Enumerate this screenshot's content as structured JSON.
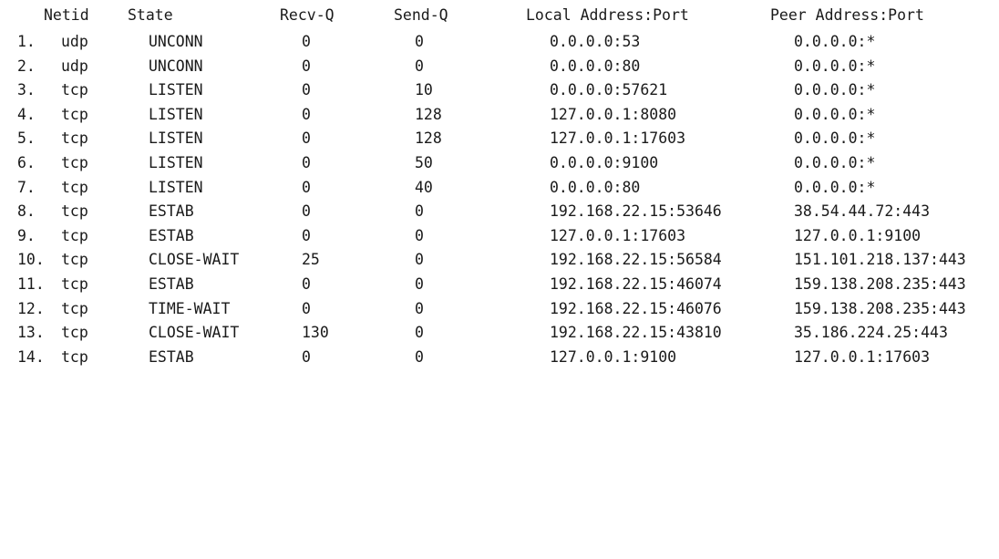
{
  "headers": {
    "netid": "Netid",
    "state": "State",
    "recv_q": "Recv-Q",
    "send_q": "Send-Q",
    "local": "Local Address:Port",
    "peer": "Peer Address:Port"
  },
  "rows": [
    {
      "num": "1.",
      "netid": "udp",
      "state": "UNCONN",
      "recv_q": "0",
      "send_q": "0",
      "local": "0.0.0.0:53",
      "peer": "0.0.0.0:*"
    },
    {
      "num": "2.",
      "netid": "udp",
      "state": "UNCONN",
      "recv_q": "0",
      "send_q": "0",
      "local": "0.0.0.0:80",
      "peer": "0.0.0.0:*"
    },
    {
      "num": "3.",
      "netid": "tcp",
      "state": "LISTEN",
      "recv_q": "0",
      "send_q": "10",
      "local": "0.0.0.0:57621",
      "peer": "0.0.0.0:*"
    },
    {
      "num": "4.",
      "netid": "tcp",
      "state": "LISTEN",
      "recv_q": "0",
      "send_q": "128",
      "local": "127.0.0.1:8080",
      "peer": "0.0.0.0:*"
    },
    {
      "num": "5.",
      "netid": "tcp",
      "state": "LISTEN",
      "recv_q": "0",
      "send_q": "128",
      "local": "127.0.0.1:17603",
      "peer": "0.0.0.0:*"
    },
    {
      "num": "6.",
      "netid": "tcp",
      "state": "LISTEN",
      "recv_q": "0",
      "send_q": "50",
      "local": "0.0.0.0:9100",
      "peer": "0.0.0.0:*"
    },
    {
      "num": "7.",
      "netid": "tcp",
      "state": "LISTEN",
      "recv_q": "0",
      "send_q": "40",
      "local": "0.0.0.0:80",
      "peer": "0.0.0.0:*"
    },
    {
      "num": "8.",
      "netid": "tcp",
      "state": "ESTAB",
      "recv_q": "0",
      "send_q": "0",
      "local": "192.168.22.15:53646",
      "peer": "38.54.44.72:443"
    },
    {
      "num": "9.",
      "netid": "tcp",
      "state": "ESTAB",
      "recv_q": "0",
      "send_q": "0",
      "local": "127.0.0.1:17603",
      "peer": "127.0.0.1:9100"
    },
    {
      "num": "10.",
      "netid": "tcp",
      "state": "CLOSE-WAIT",
      "recv_q": "25",
      "send_q": "0",
      "local": "192.168.22.15:56584",
      "peer": "151.101.218.137:443"
    },
    {
      "num": "11.",
      "netid": "tcp",
      "state": "ESTAB",
      "recv_q": "0",
      "send_q": "0",
      "local": "192.168.22.15:46074",
      "peer": "159.138.208.235:443"
    },
    {
      "num": "12.",
      "netid": "tcp",
      "state": "TIME-WAIT",
      "recv_q": "0",
      "send_q": "0",
      "local": "192.168.22.15:46076",
      "peer": "159.138.208.235:443"
    },
    {
      "num": "13.",
      "netid": "tcp",
      "state": "CLOSE-WAIT",
      "recv_q": "130",
      "send_q": "0",
      "local": "192.168.22.15:43810",
      "peer": "35.186.224.25:443"
    },
    {
      "num": "14.",
      "netid": "tcp",
      "state": "ESTAB",
      "recv_q": "0",
      "send_q": "0",
      "local": "127.0.0.1:9100",
      "peer": "127.0.0.1:17603"
    }
  ]
}
